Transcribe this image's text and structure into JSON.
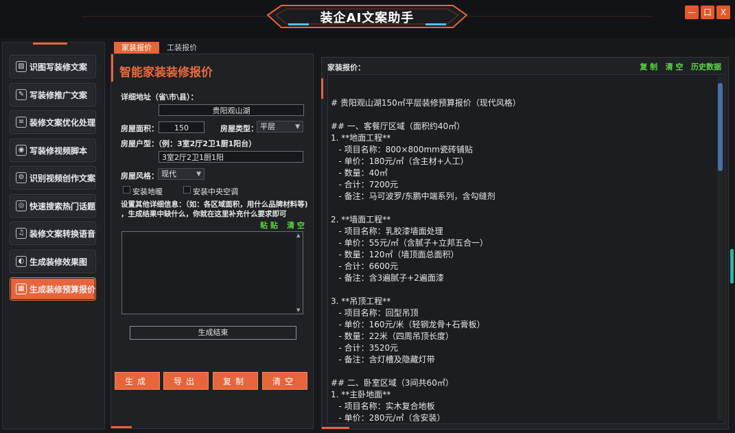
{
  "app": {
    "title": "装企AI文案助手",
    "window_buttons": {
      "minimize": "—",
      "maximize": "口",
      "close": "X"
    }
  },
  "sidebar": {
    "items": [
      {
        "label": "识图写装修文案",
        "icon": "image-icon",
        "glyph": "▨",
        "active": false
      },
      {
        "label": "写装修推广文案",
        "icon": "pen-icon",
        "glyph": "✎",
        "active": false
      },
      {
        "label": "装修文案优化处理",
        "icon": "document-icon",
        "glyph": "≡",
        "active": false
      },
      {
        "label": "写装修视频脚本",
        "icon": "camera-icon",
        "glyph": "◉",
        "active": false
      },
      {
        "label": "识别视频创作文案",
        "icon": "settings-icon",
        "glyph": "⚙",
        "active": false
      },
      {
        "label": "快速搜索热门话题",
        "icon": "location-icon",
        "glyph": "◎",
        "active": false
      },
      {
        "label": "装修文案转换语音",
        "icon": "headphones-icon",
        "glyph": "♫",
        "active": false
      },
      {
        "label": "生成装修效果图",
        "icon": "palette-icon",
        "glyph": "◐",
        "active": false
      },
      {
        "label": "生成装修预算报价",
        "icon": "calculator-icon",
        "glyph": "▦",
        "active": true
      }
    ]
  },
  "tabs": [
    {
      "label": "家装报价",
      "active": true
    },
    {
      "label": "工装报价",
      "active": false
    }
  ],
  "form": {
    "title": "智能家装装修报价",
    "address_label": "详细地址（省\\市\\县）：",
    "address_value": "贵阳观山湖",
    "area_label": "房屋面积：",
    "area_value": "150",
    "type_label": "房屋类型：",
    "type_value": "平层",
    "layout_label": "房屋户型：",
    "layout_hint": "（例：3室2厅2卫1厨1阳台）",
    "layout_value": "3室2厅2卫1厨1阳",
    "style_label": "房屋风格：",
    "style_value": "现代",
    "checkbox_floor_heating": "安装地暖",
    "checkbox_central_ac": "安装中央空调",
    "details_line1": "设置其他详细信息：（如：各区域面积，用什么品牌材料等)",
    "details_line2": "，生成结果中缺什么，你就在这里补充什么要求即可",
    "paste_label": "粘 贴",
    "clear_label": "清 空",
    "extra_value": "",
    "status_text": "生成结束",
    "buttons": {
      "generate": "生成",
      "export": "导出",
      "copy": "复制",
      "clear": "清空"
    }
  },
  "result": {
    "header": "家装报价：",
    "links": {
      "copy": "复 制",
      "clear": "清 空",
      "history": "历史数据"
    },
    "lines": [
      "# 贵阳观山湖150㎡平层装修预算报价（现代风格）",
      "",
      "## 一、客餐厅区域（面积约40㎡）",
      "1. **地面工程**",
      "   - 项目名称：800×800mm瓷砖铺贴",
      "   - 单价：180元/㎡（含主材+人工）",
      "   - 数量：40㎡",
      "   - 合计：7200元",
      "   - 备注：马可波罗/东鹏中端系列，含勾缝剂",
      "",
      "2. **墙面工程**",
      "   - 项目名称：乳胶漆墙面处理",
      "   - 单价：55元/㎡（含腻子+立邦五合一）",
      "   - 数量：120㎡（墙顶面总面积）",
      "   - 合计：6600元",
      "   - 备注：含3遍腻子+2遍面漆",
      "",
      "3. **吊顶工程**",
      "   - 项目名称：回型吊顶",
      "   - 单价：160元/米（轻钢龙骨+石膏板）",
      "   - 数量：22米（四周吊顶长度）",
      "   - 合计：3520元",
      "   - 备注：含灯槽及隐藏灯带",
      "",
      "## 二、卧室区域（3间共60㎡）",
      "1. **主卧地面**",
      "   - 项目名称：实木复合地板",
      "   - 单价：280元/㎡（含安装）"
    ]
  },
  "colors": {
    "accent": "#e8643a",
    "green": "#5bd641",
    "background": "#16181c",
    "panel": "#1f2125"
  }
}
